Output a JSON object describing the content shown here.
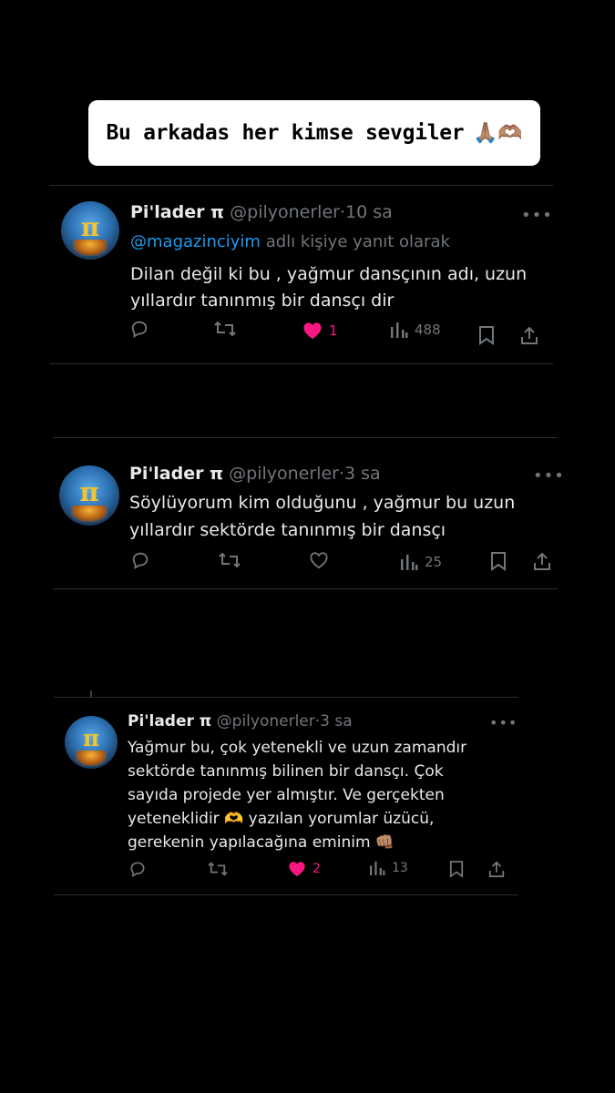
{
  "caption": {
    "text": "Bu arkadas her kimse sevgiler",
    "emoji": "🙏🏽🫶🏽"
  },
  "tweets": [
    {
      "author": "Pi'lader π",
      "handle": "@pilyonerler",
      "sep": "·",
      "time": "10 sa",
      "reply_to": {
        "mention": "@magazinciyim",
        "suffix": "adlı kişiye yanıt olarak"
      },
      "lines": [
        "Dilan değil ki bu , yağmur dansçının adı, uzun",
        "yıllardır tanınmış bir dansçı dir"
      ],
      "likes": "1",
      "liked": true,
      "views": "488"
    },
    {
      "author": "Pi'lader π",
      "handle": "@pilyonerler",
      "sep": "·",
      "time": "3 sa",
      "lines": [
        "Söylüyorum kim olduğunu , yağmur bu uzun",
        "yıllardır sektörde tanınmış bir dansçı"
      ],
      "likes": "",
      "liked": false,
      "views": "25"
    },
    {
      "author": "Pi'lader π",
      "handle": "@pilyonerler",
      "sep": "·",
      "time": "3 sa",
      "lines": [
        "Yağmur bu, çok yetenekli ve uzun zamandır",
        "sektörde tanınmış bilinen bir dansçı. Çok",
        "sayıda projede yer almıştır. Ve gerçekten",
        "yeteneklidir 🫶 yazılan yorumlar üzücü,",
        "gerekenin yapılacağına eminim 👊🏽"
      ],
      "likes": "2",
      "liked": true,
      "views": "13"
    }
  ],
  "icons": {
    "reply": "reply-icon",
    "retweet": "retweet-icon",
    "like": "heart-icon",
    "views": "views-icon",
    "bookmark": "bookmark-icon",
    "share": "share-icon",
    "more": "more-icon"
  },
  "colors": {
    "link": "#1d9bf0",
    "like": "#f91880",
    "muted": "#71767b"
  }
}
